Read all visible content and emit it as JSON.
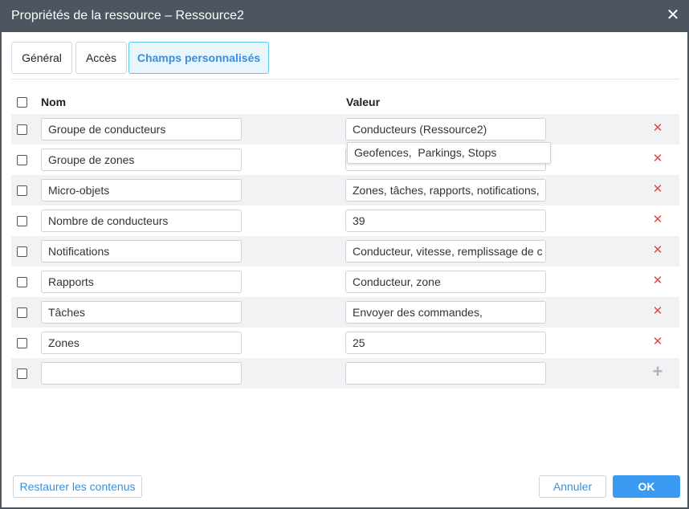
{
  "window": {
    "title": "Propriétés de la ressource – Ressource2",
    "close_icon": "close-icon"
  },
  "tabs": [
    {
      "label": "Général",
      "active": false
    },
    {
      "label": "Accès",
      "active": false
    },
    {
      "label": "Champs personnalisés",
      "active": true
    }
  ],
  "table": {
    "headers": {
      "name": "Nom",
      "value": "Valeur"
    },
    "rows": [
      {
        "name": "Groupe de conducteurs",
        "value": "Conducteurs (Ressource2)"
      },
      {
        "name": "Groupe de zones",
        "value": ""
      },
      {
        "name": "Micro-objets",
        "value": "Zones, tâches, rapports, notifications, "
      },
      {
        "name": "Nombre de conducteurs",
        "value": "39"
      },
      {
        "name": "Notifications",
        "value": "Conducteur, vitesse, remplissage de c"
      },
      {
        "name": "Rapports",
        "value": "Conducteur, zone"
      },
      {
        "name": "Tâches",
        "value": "Envoyer des commandes,"
      },
      {
        "name": "Zones",
        "value": "25"
      },
      {
        "name": "",
        "value": ""
      }
    ],
    "delete_icon": "delete-icon",
    "add_icon": "plus-icon"
  },
  "suggestion": {
    "text": "Geofences,  Parkings, Stops"
  },
  "footer": {
    "restore_label": "Restaurer les contenus",
    "cancel_label": "Annuler",
    "ok_label": "OK"
  },
  "colors": {
    "titlebar": "#4d5560",
    "accent": "#3a9af2",
    "delete": "#e64545",
    "active_tab_border": "#5ac8e6"
  }
}
